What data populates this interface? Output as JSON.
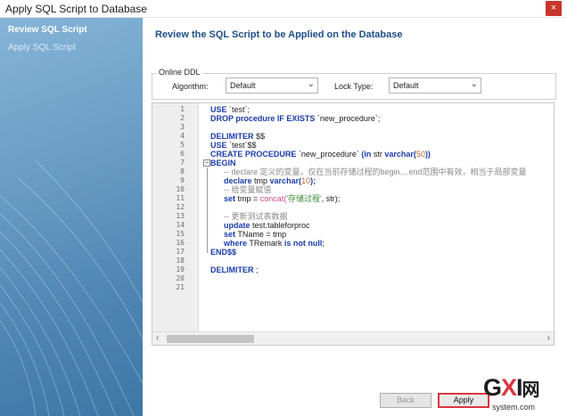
{
  "window": {
    "title": "Apply SQL Script to Database",
    "close_glyph": "×"
  },
  "sidebar": {
    "steps": [
      {
        "label": "Review SQL Script",
        "active": true
      },
      {
        "label": "Apply SQL Script",
        "active": false
      }
    ]
  },
  "main": {
    "heading": "Review the SQL Script to be Applied on the Database",
    "online_ddl": {
      "legend": "Online DDL",
      "algorithm_label": "Algorithm:",
      "algorithm_value": "Default",
      "lock_type_label": "Lock Type:",
      "lock_type_value": "Default"
    },
    "line_numbers": [
      "1",
      "2",
      "3",
      "4",
      "5",
      "6",
      "7",
      "8",
      "9",
      "10",
      "11",
      "12",
      "13",
      "14",
      "15",
      "16",
      "17",
      "18",
      "19",
      "20",
      "21"
    ],
    "code": {
      "l1_kw": "USE",
      "l1_rest": " `test`;",
      "l2_kw": "DROP procedure IF EXISTS",
      "l2_rest": " `new_procedure`;",
      "l4_kw": "DELIMITER",
      "l4_rest": " $$",
      "l5_kw": "USE",
      "l5_rest": " `test`$$",
      "l6_kw": "CREATE PROCEDURE",
      "l6_name": " `new_procedure` ",
      "l6_paren": "(in",
      "l6_param": " str ",
      "l6_type": "varchar(",
      "l6_num": "50",
      "l6_close": "))",
      "l7_kw": "BEGIN",
      "l8_comment": "-- declare 定义的变量，仅在当前存储过程的begin....end范围中有效，相当于局部变量",
      "l9_kw": "declare",
      "l9_rest": " tmp ",
      "l9_type": "varchar(",
      "l9_num": "10",
      "l9_close": ");",
      "l10_comment": "-- 给变量赋值",
      "l11_kw": "set",
      "l11_rest": " tmp = ",
      "l11_fn": "concat(",
      "l11_str": "'存储过程'",
      "l11_end": ", str);",
      "l13_comment": "-- 更新测试表数据",
      "l14_kw": "update",
      "l14_rest": " test.tableforproc",
      "l15_kw": "set",
      "l15_rest": " TName = tmp",
      "l16_kw": "where",
      "l16_rest": " TRemark ",
      "l16_kw2": "is not null",
      "l16_end": ";",
      "l17_kw": "END",
      "l17_rest": "$$",
      "l19_kw": "DELIMITER",
      "l19_rest": " ;"
    }
  },
  "footer": {
    "back_label": "Back",
    "apply_label": "Apply"
  },
  "watermark": {
    "g": "G",
    "x": "X",
    "i": "I",
    "suffix": "网",
    "domain": "system.com"
  },
  "colors": {
    "heading": "#1f4f85",
    "keyword": "#1b3ca8",
    "apply_highlight": "#d8363f"
  }
}
